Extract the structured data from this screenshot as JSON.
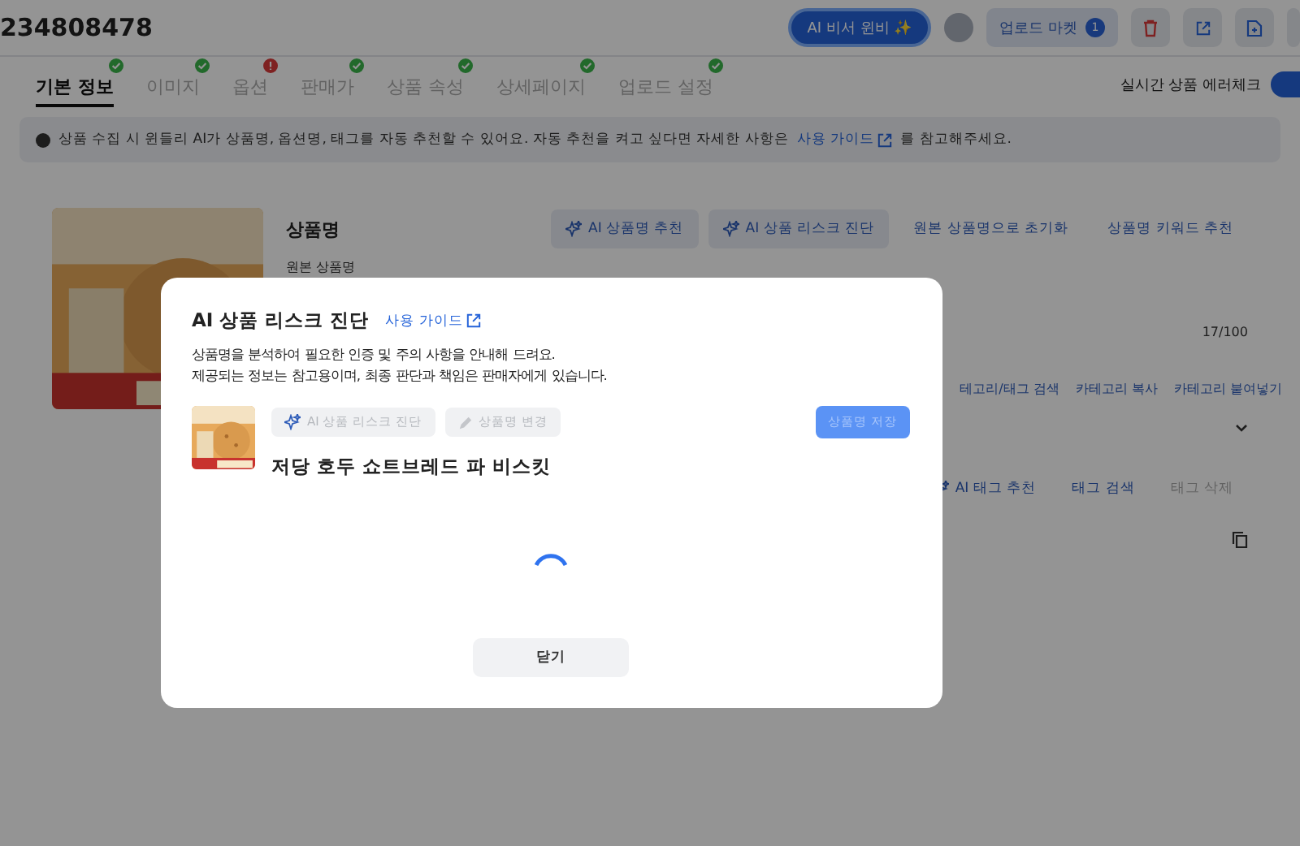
{
  "header": {
    "product_id": "234808478",
    "assistant_button": "AI 비서 윈비 ✨",
    "upload_market": {
      "label": "업로드 마켓",
      "count": "1"
    }
  },
  "tabs": [
    {
      "label": "기본 정보",
      "selected": true,
      "complete": true
    },
    {
      "label": "이미지",
      "selected": false,
      "complete": true
    },
    {
      "label": "옵션",
      "selected": false,
      "complete": false
    },
    {
      "label": "판매가",
      "selected": false,
      "complete": true
    },
    {
      "label": "상품 속성",
      "selected": false,
      "complete": true
    },
    {
      "label": "상세페이지",
      "selected": false,
      "complete": true
    },
    {
      "label": "업로드 설정",
      "selected": false,
      "complete": true
    }
  ],
  "error_check": {
    "label": "실시간 상품 에러체크",
    "on": true
  },
  "notice": {
    "text": "상품 수집 시 윈들리 AI가 상품명, 옵션명, 태그를 자동 추천할 수 있어요. 자동 추천을 켜고 싶다면 자세한 사항은",
    "link": "사용 가이드",
    "suffix": "를 참고해주세요."
  },
  "product": {
    "title_label": "상품명",
    "original_label": "원본 상품명",
    "actions": [
      {
        "label": "AI 상품명 추천",
        "kind": "ai"
      },
      {
        "label": "AI 상품 리스크 진단",
        "kind": "ai"
      },
      {
        "label": "원본 상품명으로 초기화",
        "kind": "plain"
      },
      {
        "label": "상품명 키워드 추천",
        "kind": "plain"
      }
    ],
    "char_count": "17/100",
    "category_actions": [
      "테고리/태그 검색",
      "카테고리 복사",
      "카테고리 붙여넣기"
    ],
    "tag_actions": [
      {
        "label": "AI 태그 추천",
        "kind": "ai",
        "disabled": false
      },
      {
        "label": "태그 검색",
        "kind": "plain",
        "disabled": false
      },
      {
        "label": "태그 삭제",
        "kind": "plain",
        "disabled": true
      }
    ]
  },
  "modal": {
    "title": "AI 상품 리스크 진단",
    "guide_link": "사용 가이드",
    "description": [
      "상품명을 분석하여 필요한 인증 및 주의 사항을 안내해 드려요.",
      "제공되는 정보는 참고용이며, 최종 판단과 책임은 판매자에게 있습니다."
    ],
    "actions": [
      {
        "label": "AI 상품 리스크 진단",
        "kind": "ai",
        "disabled": true
      },
      {
        "label": "상품명 변경",
        "kind": "edit",
        "disabled": true
      }
    ],
    "save_button": {
      "label": "상품명 저장",
      "disabled": true
    },
    "product_name": "저당 호두 쇼트브레드 파 비스킷",
    "loading": true,
    "close_button": "닫기"
  }
}
